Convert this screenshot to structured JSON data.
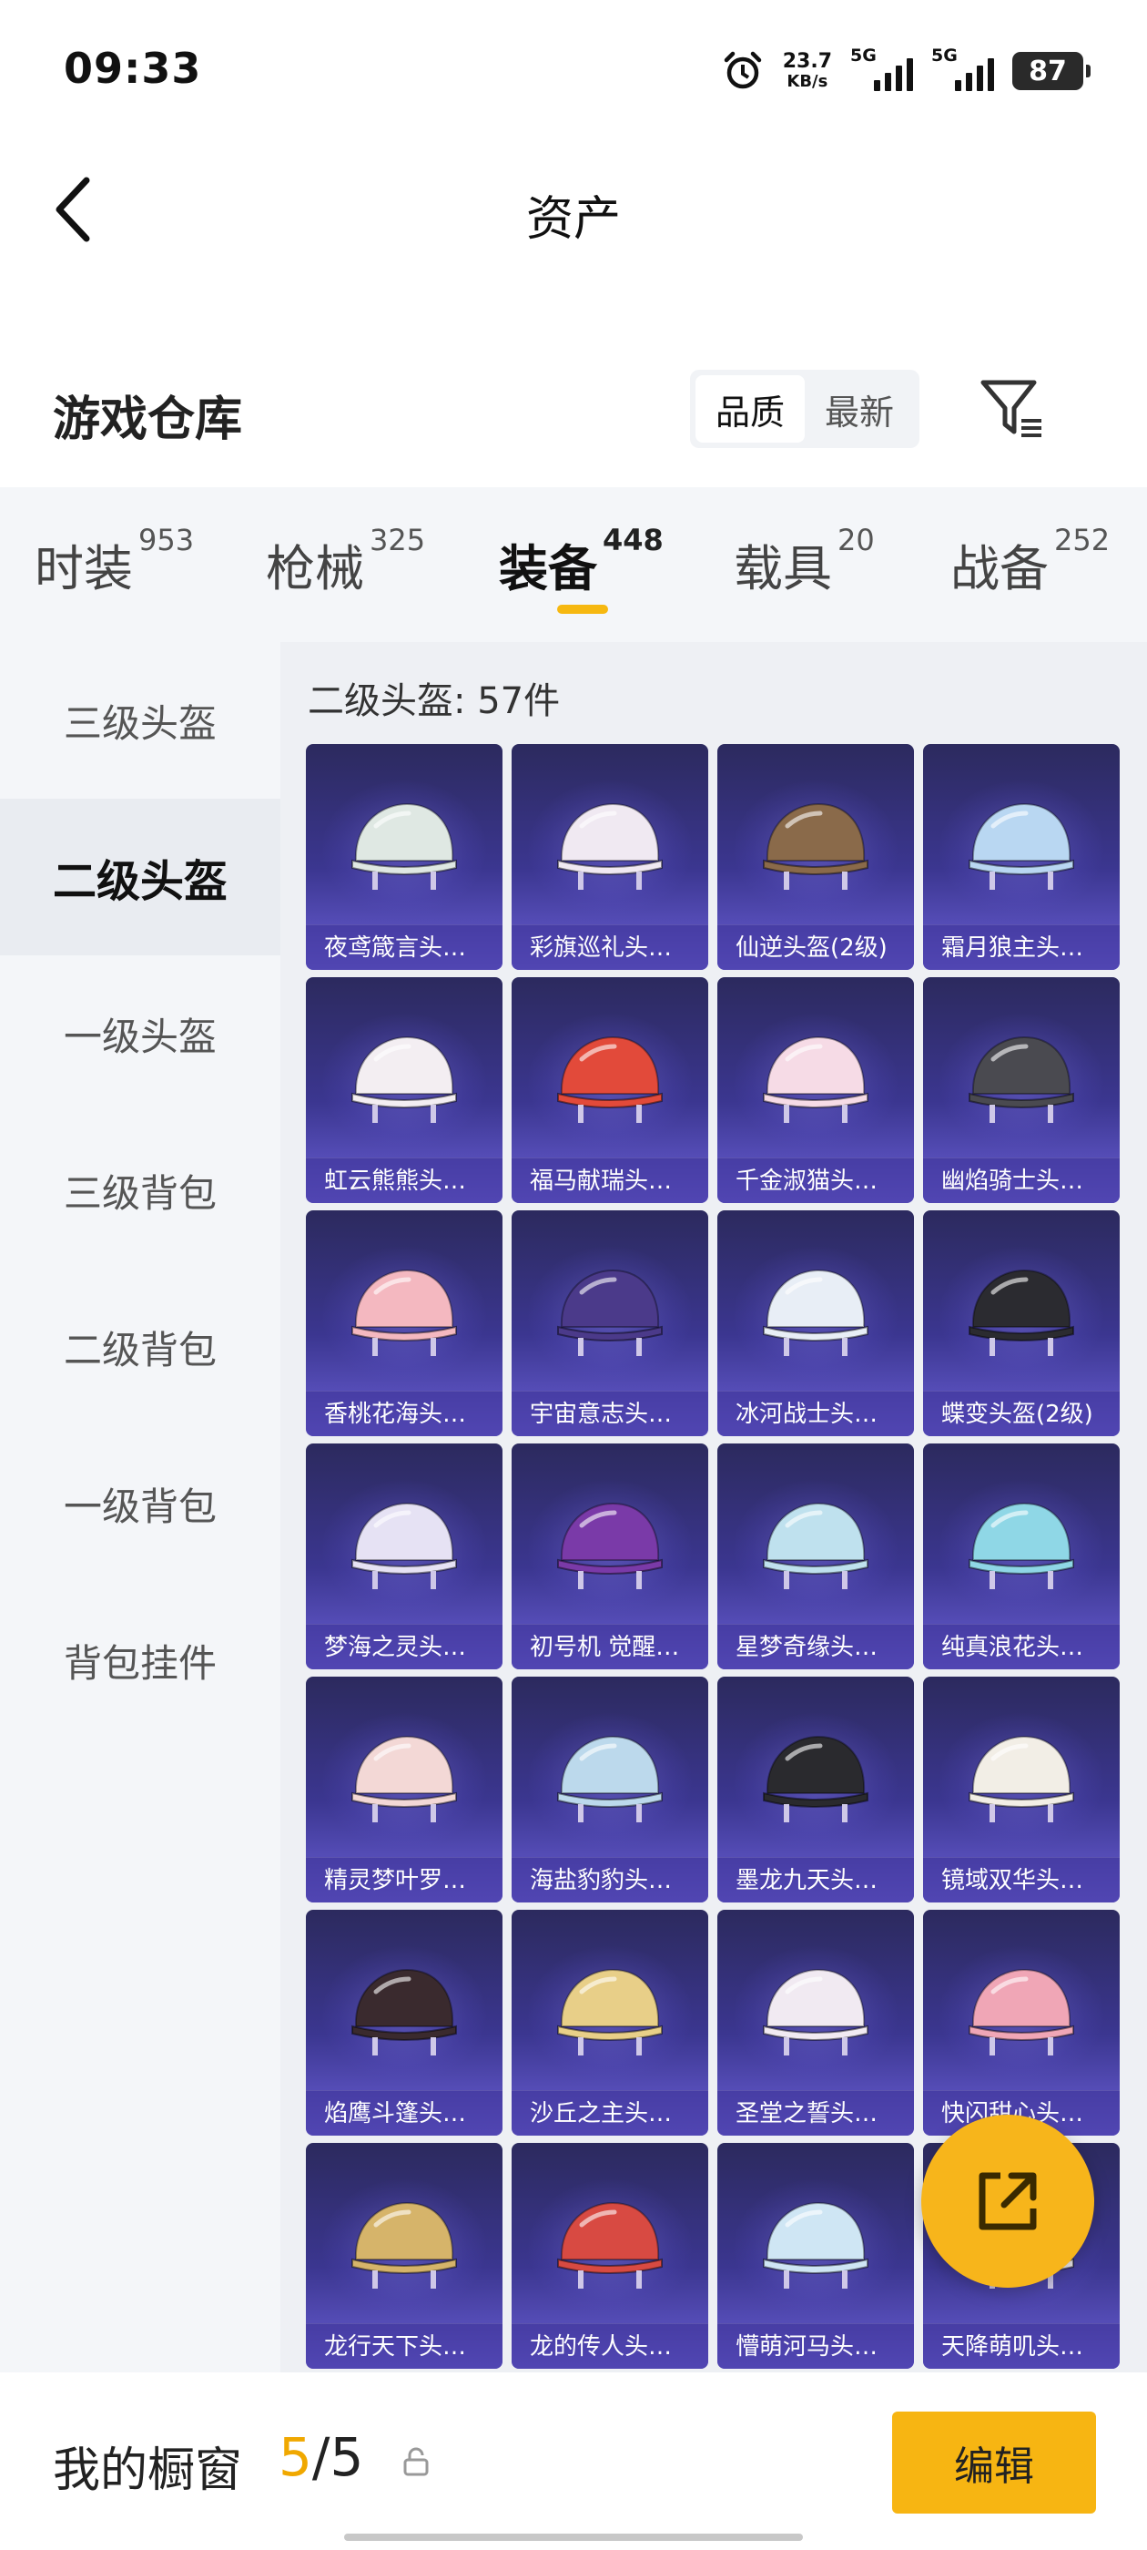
{
  "status_bar": {
    "time": "09:33",
    "net_speed": "23.7",
    "net_unit": "KB/s",
    "sim1": "5G",
    "sim2": "5G",
    "battery": "87"
  },
  "header": {
    "title": "资产",
    "back_icon": "chevron-left-icon"
  },
  "section": {
    "title": "游戏仓库",
    "sort_options": [
      "品质",
      "最新"
    ],
    "sort_selected": "品质",
    "filter_icon": "filter-icon"
  },
  "tabs": [
    {
      "label": "时装",
      "count": "953"
    },
    {
      "label": "枪械",
      "count": "325"
    },
    {
      "label": "装备",
      "count": "448"
    },
    {
      "label": "载具",
      "count": "20"
    },
    {
      "label": "战备",
      "count": "252"
    }
  ],
  "active_tab": "装备",
  "sidebar": {
    "items": [
      "三级头盔",
      "二级头盔",
      "一级头盔",
      "三级背包",
      "二级背包",
      "一级背包",
      "背包挂件"
    ],
    "selected": "二级头盔"
  },
  "content": {
    "count_label": "二级头盔: 57件",
    "items": [
      {
        "name": "夜鸢箴言头…",
        "color": "#dfe8e3"
      },
      {
        "name": "彩旗巡礼头…",
        "color": "#f0e9f2"
      },
      {
        "name": "仙逆头盔(2级)",
        "color": "#8a6a4a"
      },
      {
        "name": "霜月狼主头…",
        "color": "#b9d7f2"
      },
      {
        "name": "虹云熊熊头…",
        "color": "#f3eef2"
      },
      {
        "name": "福马献瑞头…",
        "color": "#e24a3a"
      },
      {
        "name": "千金淑猫头…",
        "color": "#f6dbe6"
      },
      {
        "name": "幽焰骑士头…",
        "color": "#4a4a50"
      },
      {
        "name": "香桃花海头…",
        "color": "#f4b8c0"
      },
      {
        "name": "宇宙意志头…",
        "color": "#4b3a8a"
      },
      {
        "name": "冰河战士头…",
        "color": "#e8eef6"
      },
      {
        "name": "蝶变头盔(2级)",
        "color": "#2b2b30"
      },
      {
        "name": "梦海之灵头…",
        "color": "#e6e2f4"
      },
      {
        "name": "初号机 觉醒…",
        "color": "#7a3aa8"
      },
      {
        "name": "星梦奇缘头…",
        "color": "#bfe1ee"
      },
      {
        "name": "纯真浪花头…",
        "color": "#8fd7e6"
      },
      {
        "name": "精灵梦叶罗…",
        "color": "#f3d8d6"
      },
      {
        "name": "海盐豹豹头…",
        "color": "#bcd9ec"
      },
      {
        "name": "墨龙九天头…",
        "color": "#2a2a2e"
      },
      {
        "name": "镜域双华头…",
        "color": "#f2eee6"
      },
      {
        "name": "焰鹰斗篷头…",
        "color": "#3a2a2e"
      },
      {
        "name": "沙丘之主头…",
        "color": "#e8cf88"
      },
      {
        "name": "圣堂之誓头…",
        "color": "#f1eaf2"
      },
      {
        "name": "快闪甜心头…",
        "color": "#f0a6b6"
      },
      {
        "name": "龙行天下头…",
        "color": "#d6b46a"
      },
      {
        "name": "龙的传人头…",
        "color": "#d84a42"
      },
      {
        "name": "懵萌河马头…",
        "color": "#cfe6f4"
      },
      {
        "name": "天降萌叽头…",
        "color": "#f3eef0"
      }
    ]
  },
  "fab": {
    "icon": "share-external-icon"
  },
  "bottom": {
    "label": "我的橱窗",
    "current": "5",
    "separator": "/",
    "total": "5",
    "lock_icon": "lock-icon",
    "edit_label": "编辑"
  }
}
